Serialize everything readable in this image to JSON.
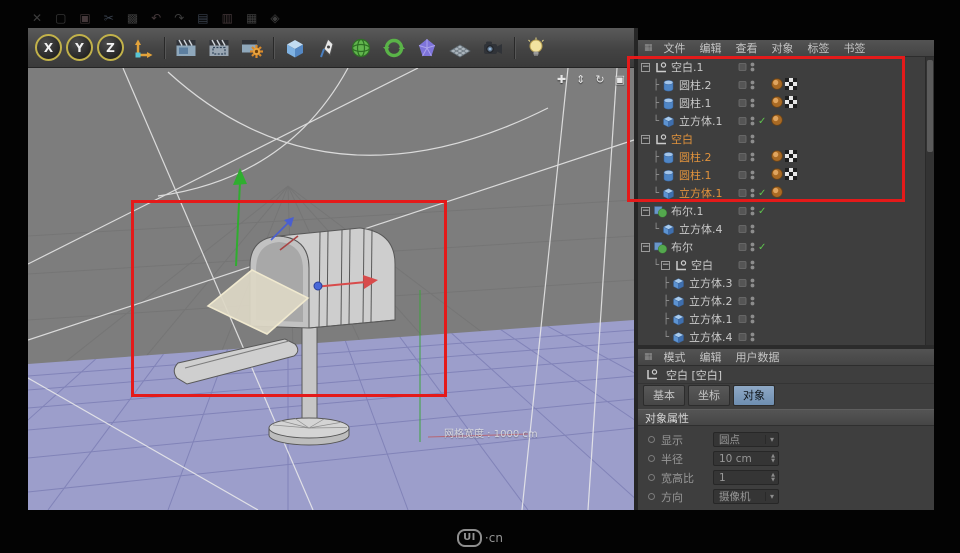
{
  "colors": {
    "selection_orange": "#e0923c",
    "annotation_red": "#e41a1a",
    "tab_active_blue": "#6e8eb1",
    "check_green": "#5ec14e"
  },
  "watermark": {
    "logo": "UI",
    "suffix": "·cn"
  },
  "panel_menu_glyph": "▦",
  "top_strip": {
    "icons": [
      {
        "name": "close-icon",
        "glyph": "✕"
      },
      {
        "name": "new-scene-icon",
        "glyph": "▢"
      },
      {
        "name": "save-icon",
        "glyph": "▣"
      },
      {
        "name": "cut-icon",
        "glyph": "✂"
      },
      {
        "name": "copy-icon",
        "glyph": "▩"
      },
      {
        "name": "undo-icon",
        "glyph": "↶"
      },
      {
        "name": "redo-icon",
        "glyph": "↷"
      },
      {
        "name": "layout-icon",
        "glyph": "▤"
      },
      {
        "name": "panel-icon",
        "glyph": "▥"
      },
      {
        "name": "grid-icon",
        "glyph": "▦"
      },
      {
        "name": "gem-icon",
        "glyph": "◈"
      }
    ]
  },
  "toolbar": {
    "axis_buttons": [
      {
        "label": "X"
      },
      {
        "label": "Y"
      },
      {
        "label": "Z"
      }
    ],
    "tools": [
      "coordinate-system",
      "|",
      "render-view",
      "render-region",
      "render-settings",
      "|",
      "cube-primitive",
      "spline-pen",
      "subdivision-surface",
      "generators",
      "deformers",
      "floor",
      "camera",
      "|",
      "light"
    ]
  },
  "viewport": {
    "hud_label": "网格宽度 : 1000 cm",
    "nav_controls": [
      {
        "name": "pan-icon",
        "glyph": "✚"
      },
      {
        "name": "dolly-icon",
        "glyph": "⇕"
      },
      {
        "name": "orbit-icon",
        "glyph": "↻"
      },
      {
        "name": "toggle-view-icon",
        "glyph": "▣"
      }
    ]
  },
  "object_manager": {
    "menu": [
      "文件",
      "编辑",
      "查看",
      "对象",
      "标签",
      "书签"
    ],
    "rows": [
      {
        "label": "空白.1",
        "icon": "null",
        "depth": 0,
        "expander": true,
        "selected": false,
        "check": false,
        "tags": []
      },
      {
        "label": "圆柱.2",
        "icon": "cylinder",
        "depth": 1,
        "branch": "├",
        "selected": false,
        "check": false,
        "tags": [
          "material",
          "texture"
        ]
      },
      {
        "label": "圆柱.1",
        "icon": "cylinder",
        "depth": 1,
        "branch": "├",
        "selected": false,
        "check": false,
        "tags": [
          "material",
          "texture"
        ]
      },
      {
        "label": "立方体.1",
        "icon": "cube",
        "depth": 1,
        "branch": "└",
        "selected": false,
        "check": true,
        "tags": [
          "material"
        ]
      },
      {
        "label": "空白",
        "icon": "null",
        "depth": 0,
        "expander": true,
        "selected": true,
        "check": false,
        "tags": []
      },
      {
        "label": "圆柱.2",
        "icon": "cylinder",
        "depth": 1,
        "branch": "├",
        "selected": true,
        "check": false,
        "tags": [
          "material",
          "texture"
        ]
      },
      {
        "label": "圆柱.1",
        "icon": "cylinder",
        "depth": 1,
        "branch": "├",
        "selected": true,
        "check": false,
        "tags": [
          "material",
          "texture"
        ]
      },
      {
        "label": "立方体.1",
        "icon": "cube",
        "depth": 1,
        "branch": "└",
        "selected": true,
        "check": true,
        "tags": [
          "material"
        ]
      },
      {
        "label": "布尔.1",
        "icon": "boole",
        "depth": 0,
        "expander": true,
        "selected": false,
        "check": true,
        "tags": []
      },
      {
        "label": "立方体.4",
        "icon": "cube",
        "depth": 1,
        "branch": "└",
        "selected": false,
        "check": false,
        "tags": []
      },
      {
        "label": "布尔",
        "icon": "boole",
        "depth": 0,
        "expander": true,
        "selected": false,
        "check": true,
        "tags": []
      },
      {
        "label": "空白",
        "icon": "null",
        "depth": 1,
        "branch": "└",
        "expander": true,
        "selected": false,
        "check": false,
        "tags": []
      },
      {
        "label": "立方体.3",
        "icon": "cube",
        "depth": 2,
        "branch": "├",
        "selected": false,
        "check": false,
        "tags": []
      },
      {
        "label": "立方体.2",
        "icon": "cube",
        "depth": 2,
        "branch": "├",
        "selected": false,
        "check": false,
        "tags": []
      },
      {
        "label": "立方体.1",
        "icon": "cube",
        "depth": 2,
        "branch": "├",
        "selected": false,
        "check": false,
        "tags": []
      },
      {
        "label": "立方体.4",
        "icon": "cube",
        "depth": 2,
        "branch": "└",
        "selected": false,
        "check": false,
        "tags": []
      }
    ]
  },
  "attribute_manager": {
    "menu": [
      "模式",
      "编辑",
      "用户数据"
    ],
    "object_title": "空白 [空白]",
    "tabs": [
      {
        "key": "basic",
        "label": "基本",
        "active": false
      },
      {
        "key": "coord",
        "label": "坐标",
        "active": false
      },
      {
        "key": "object",
        "label": "对象",
        "active": true
      }
    ],
    "section_title": "对象属性",
    "properties": [
      {
        "key": "display",
        "label": "显示",
        "value": "圆点",
        "control": "dropdown"
      },
      {
        "key": "radius",
        "label": "半径",
        "value": "10 cm",
        "control": "number"
      },
      {
        "key": "aspect-ratio",
        "label": "宽高比",
        "value": "1",
        "control": "number"
      },
      {
        "key": "orientation",
        "label": "方向",
        "value": "摄像机",
        "control": "dropdown"
      }
    ]
  }
}
